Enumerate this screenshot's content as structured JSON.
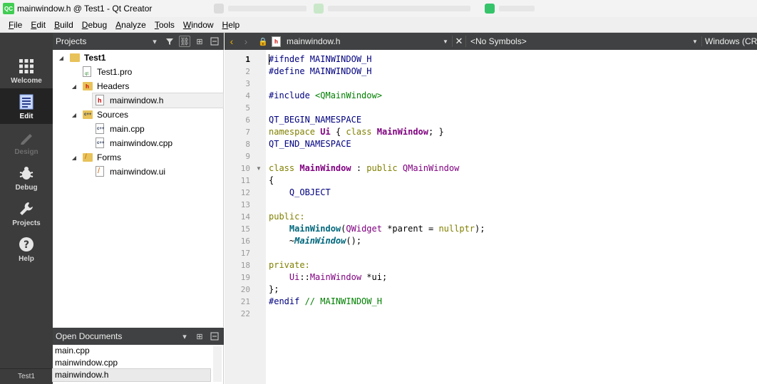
{
  "titlebar": {
    "app_icon": "QC",
    "title": "mainwindow.h @ Test1 - Qt Creator"
  },
  "menu": [
    {
      "u": "F",
      "rest": "ile"
    },
    {
      "u": "E",
      "rest": "dit"
    },
    {
      "u": "B",
      "rest": "uild"
    },
    {
      "u": "D",
      "rest": "ebug"
    },
    {
      "u": "A",
      "rest": "nalyze"
    },
    {
      "u": "T",
      "rest": "ools"
    },
    {
      "u": "W",
      "rest": "indow"
    },
    {
      "u": "H",
      "rest": "elp"
    }
  ],
  "modes": {
    "welcome": "Welcome",
    "edit": "Edit",
    "design": "Design",
    "debug": "Debug",
    "projects": "Projects",
    "help": "Help",
    "target": "Test1"
  },
  "projects_pane": {
    "title": "Projects"
  },
  "tree": {
    "root": "Test1",
    "pro": "Test1.pro",
    "headers": "Headers",
    "header_file": "mainwindow.h",
    "sources": "Sources",
    "src1": "main.cpp",
    "src2": "mainwindow.cpp",
    "forms": "Forms",
    "form1": "mainwindow.ui"
  },
  "open_documents": {
    "title": "Open Documents",
    "items": [
      "main.cpp",
      "mainwindow.cpp",
      "mainwindow.h"
    ]
  },
  "editor_toolbar": {
    "file": "mainwindow.h",
    "symbols": "<No Symbols>",
    "split": "Windows (CRLF)",
    "file_icon": "h"
  },
  "code": {
    "line_numbers": [
      "1",
      "2",
      "3",
      "4",
      "5",
      "6",
      "7",
      "8",
      "9",
      "10",
      "11",
      "12",
      "13",
      "14",
      "15",
      "16",
      "17",
      "18",
      "19",
      "20",
      "21",
      "22"
    ],
    "l1a": "#ifndef",
    "l1b": " MAINWINDOW_H",
    "l2a": "#define",
    "l2b": " MAINWINDOW_H",
    "l4a": "#include",
    "l4b": " <QMainWindow>",
    "l6": "QT_BEGIN_NAMESPACE",
    "l7a": "namespace",
    "l7b": " Ui",
    "l7c": " { ",
    "l7d": "class",
    "l7e": " MainWindow",
    "l7f": "; }",
    "l8": "QT_END_NAMESPACE",
    "l10a": "class",
    "l10b": " MainWindow",
    "l10c": " : ",
    "l10d": "public",
    "l10e": " QMainWindow",
    "l11": "{",
    "l12": "    Q_OBJECT",
    "l14": "public:",
    "l15a": "    MainWindow",
    "l15b": "(",
    "l15c": "QWidget",
    "l15d": " *parent = ",
    "l15e": "nullptr",
    "l15f": ");",
    "l16a": "    ~",
    "l16b": "MainWindow",
    "l16c": "();",
    "l18": "private:",
    "l19a": "    Ui",
    "l19b": "::",
    "l19c": "MainWindow",
    "l19d": " *ui;",
    "l20": "};",
    "l21a": "#endif",
    "l21b": " // MAINWINDOW_H"
  },
  "colors": {
    "accent_green": "#41cd52",
    "sidebar_dark": "#3c3c3c",
    "header_dark": "#404142"
  }
}
